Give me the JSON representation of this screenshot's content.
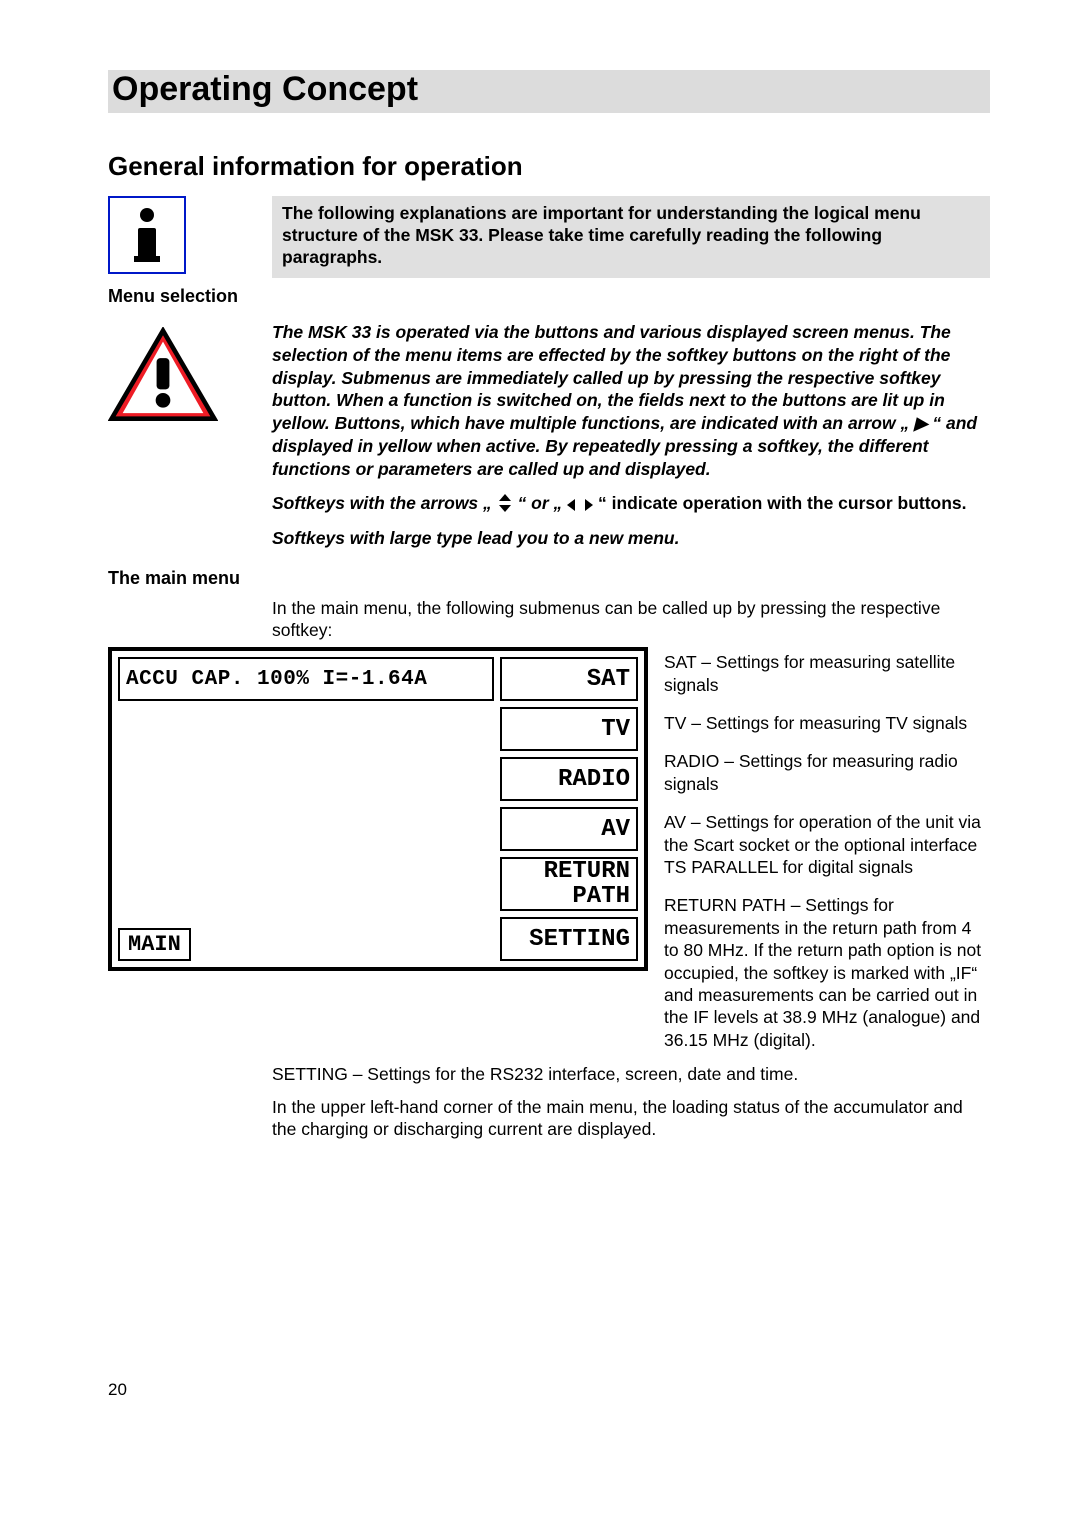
{
  "page_number": "20",
  "title": "Operating Concept",
  "h2": "General information for operation",
  "note_gray": "The following explanations are important for understanding the logical menu structure of the MSK 33. Please take time carefully reading the following paragraphs.",
  "sub_menu_selection": "Menu selection",
  "warn_para": "The MSK 33 is operated via the buttons and various displayed screen menus. The selection of the menu items are effected by the softkey buttons on the right of the display. Submenus are immediately called up by pressing the respective softkey button.  When a function is switched on, the fields next to the buttons are lit up in yellow. Buttons, which have multiple functions, are indicated with an arrow „ ▶ “  and displayed in yellow when active. By repeatedly pressing a softkey, the different functions or parameters are called up and displayed.",
  "softkey_cursor_pre": "Softkeys with the arrows „",
  "softkey_cursor_mid": "“ or „",
  "softkey_cursor_post": "“ indicate  operation with the cursor buttons.",
  "softkey_large": "Softkeys with large type lead you to a new menu.",
  "sub_main_menu": "The main menu",
  "main_menu_intro": "In the main menu, the following submenus can be called up by pressing the respective softkey:",
  "screen": {
    "status": "ACCU CAP. 100% I=-1.64A",
    "soft1": "SAT",
    "soft2": "TV",
    "soft3": "RADIO",
    "soft4": "AV",
    "soft5a": "RETURN",
    "soft5b": "PATH",
    "soft6": "SETTING",
    "label": "MAIN"
  },
  "desc": {
    "sat": "SAT – Settings for measuring satellite signals",
    "tv": "TV – Settings for measuring TV signals",
    "radio": "RADIO – Settings for measuring radio signals",
    "av": "AV – Settings for operation of the unit via the Scart socket or the optional interface TS PARALLEL for digital signals",
    "return": "RETURN PATH – Settings for measurements in the return path from 4 to 80 MHz. If the return path option is not occupied, the softkey is marked with „IF“ and measurements can be carried out in the IF levels at 38.9 MHz (analogue) and 36.15 MHz (digital)."
  },
  "setting": "SETTING – Settings for the RS232 interface, screen, date and time.",
  "upper_left": "In the upper left-hand  corner of the main menu, the loading status of the accumulator and the charging or discharging current are displayed."
}
